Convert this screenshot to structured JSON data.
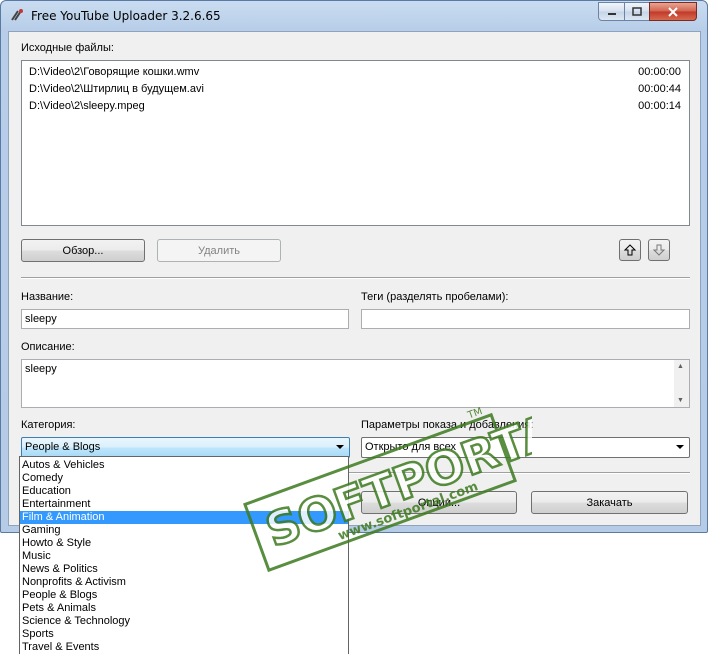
{
  "window": {
    "title": "Free YouTube Uploader 3.2.6.65"
  },
  "files": {
    "label": "Исходные файлы:",
    "items": [
      {
        "name": "D:\\Video\\2\\Говорящие кошки.wmv",
        "duration": "00:00:00"
      },
      {
        "name": "D:\\Video\\2\\Штирлиц в будущем.avi",
        "duration": "00:00:44"
      },
      {
        "name": "D:\\Video\\2\\sleepy.mpeg",
        "duration": "00:00:14"
      }
    ],
    "browse_label": "Обзор...",
    "delete_label": "Удалить"
  },
  "form": {
    "title_label": "Название:",
    "title_value": "sleepy",
    "tags_label": "Теги (разделять пробелами):",
    "tags_value": "",
    "description_label": "Описание:",
    "description_value": "sleepy",
    "category_label": "Категория:",
    "category_value": "People & Blogs",
    "privacy_label": "Параметры показа и добавления:",
    "privacy_value": "Открыто для всех"
  },
  "buttons": {
    "options_label": "Опции...",
    "upload_label": "Закачать"
  },
  "category_options": [
    "Autos & Vehicles",
    "Comedy",
    "Education",
    "Entertainment",
    "Film & Animation",
    "Gaming",
    "Howto & Style",
    "Music",
    "News & Politics",
    "Nonprofits & Activism",
    "People & Blogs",
    "Pets & Animals",
    "Science & Technology",
    "Sports",
    "Travel & Events"
  ],
  "highlighted_option": "Film & Animation",
  "watermark": {
    "brand": "SOFTPORTAL",
    "url": "www.softportal.com",
    "tm": "TM"
  },
  "colors": {
    "selection": "#3399ff",
    "watermark": "#3d7a1e"
  }
}
